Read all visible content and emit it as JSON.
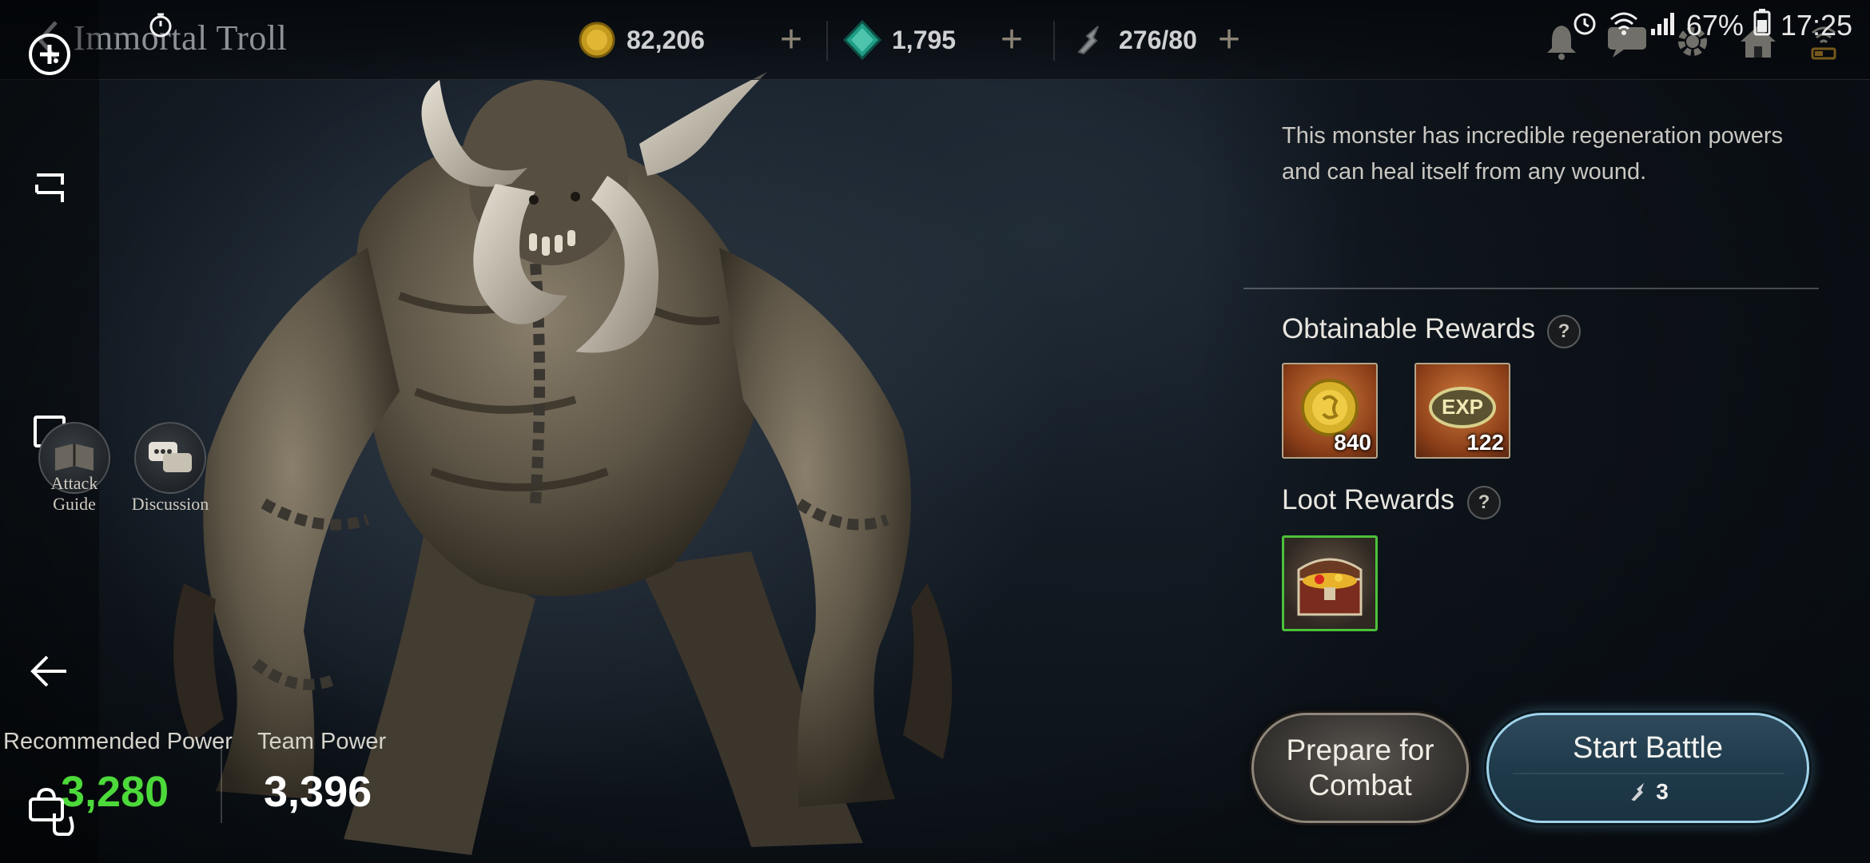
{
  "header": {
    "title": "Immortal Troll",
    "currencies": [
      {
        "icon": "gold-coin-icon",
        "amount": "82,206"
      },
      {
        "icon": "green-gem-icon",
        "amount": "1,795"
      },
      {
        "icon": "stamina-icon",
        "amount": "276/80"
      }
    ]
  },
  "status_bar": {
    "battery": "67%",
    "time": "17:25"
  },
  "side_buttons": {
    "attack_guide": "Attack\nGuide",
    "discussion": "Discussion"
  },
  "power": {
    "recommended_label": "Recommended Power",
    "recommended_value": "3,280",
    "team_label": "Team Power",
    "team_value": "3,396",
    "recommended_color": "#4cd93a"
  },
  "panel": {
    "description": "This monster has incredible regeneration powers and can heal itself from any wound.",
    "obtainable_title": "Obtainable Rewards",
    "obtainable": [
      {
        "icon": "gold-coin-icon",
        "count": "840"
      },
      {
        "icon": "exp-icon",
        "label": "EXP",
        "count": "122"
      }
    ],
    "loot_title": "Loot Rewards",
    "loot": [
      {
        "icon": "treasure-chest-icon"
      }
    ],
    "help_symbol": "?"
  },
  "actions": {
    "prepare_label": "Prepare for Combat",
    "start_label": "Start Battle",
    "start_cost": "3"
  },
  "colors": {
    "accent_blue": "#9fd3ea",
    "loot_border": "#4cc13a"
  }
}
